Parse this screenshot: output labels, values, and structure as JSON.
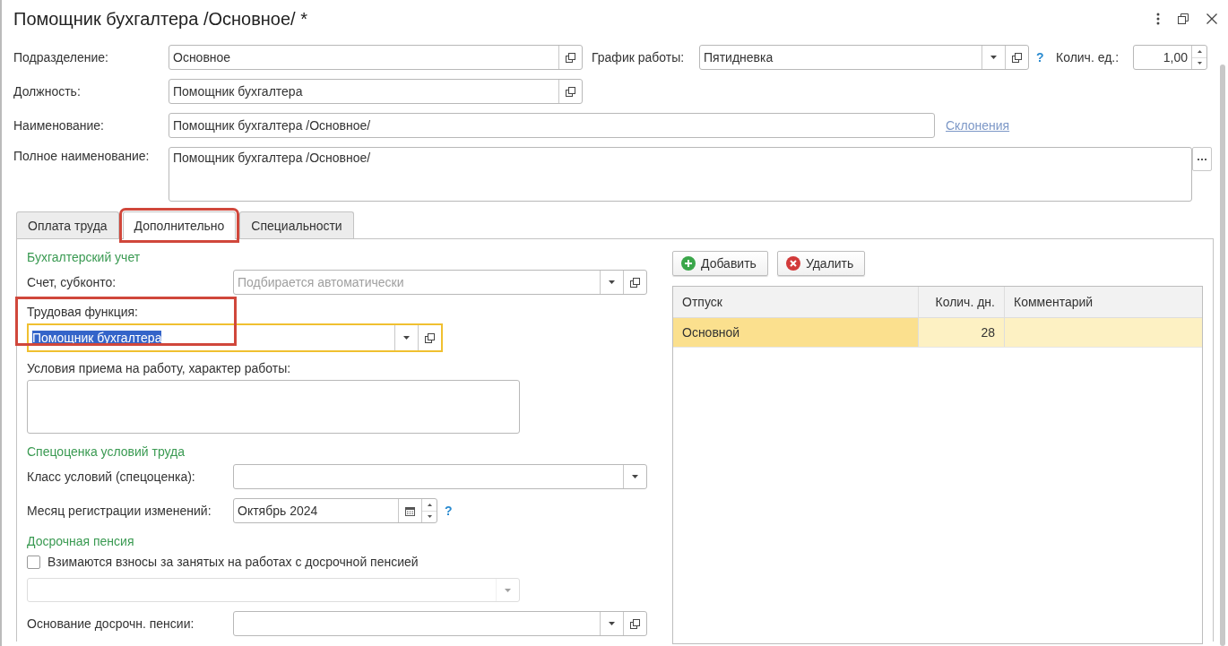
{
  "window": {
    "title": "Помощник бухгалтера /Основное/ *"
  },
  "header_rows": [
    [
      {
        "label": "Подразделение:",
        "value": "Основное",
        "controls": [
          {
            "kind": "open"
          }
        ]
      },
      {
        "label": "График работы:",
        "value": "Пятидневка",
        "controls": [
          {
            "kind": "dropdown"
          },
          {
            "kind": "open"
          }
        ],
        "help": "?"
      },
      {
        "label": "Колич. ед.:",
        "value": "1,00",
        "controls": [
          {
            "kind": "spin"
          }
        ]
      }
    ],
    [
      {
        "label": "Должность:",
        "value": "Помощник бухгалтера",
        "controls": [
          {
            "kind": "open"
          }
        ]
      }
    ],
    [
      {
        "label": "Наименование:",
        "value": "Помощник бухгалтера /Основное/",
        "link": "Склонения"
      }
    ],
    [
      {
        "label": "Полное наименование:",
        "value": "Помощник бухгалтера /Основное/",
        "controls": [
          {
            "kind": "more"
          }
        ],
        "multiline": true
      }
    ]
  ],
  "tabs": [
    {
      "label": "Оплата труда",
      "selected": false,
      "highlighted": false
    },
    {
      "label": "Дополнительно",
      "selected": true,
      "highlighted": true
    },
    {
      "label": "Специальности",
      "selected": false,
      "highlighted": false
    }
  ],
  "left_panel": [
    {
      "kind": "heading",
      "text": "Бухгалтерский учет"
    },
    {
      "kind": "inline_field",
      "label": "Счет, субконто:",
      "placeholder": "Подбирается автоматически",
      "controls": [
        {
          "kind": "dropdown"
        },
        {
          "kind": "open"
        }
      ],
      "focused": false
    },
    {
      "kind": "stacked_field",
      "label": "Трудовая функция:",
      "value": "Помощник бухгалтера",
      "controls": [
        {
          "kind": "dropdown"
        },
        {
          "kind": "open"
        }
      ],
      "focused": true,
      "highlighted": true
    },
    {
      "kind": "textarea",
      "label": "Условия приема на работу, характер работы:"
    },
    {
      "kind": "heading",
      "text": "Спецоценка условий труда"
    },
    {
      "kind": "inline_field",
      "label": "Класс условий (спецоценка):",
      "controls": [
        {
          "kind": "dropdown"
        }
      ],
      "focused": false
    },
    {
      "kind": "date_field",
      "label": "Месяц регистрации изменений:",
      "value": "Октябрь 2024",
      "controls": [
        {
          "kind": "calendar"
        },
        {
          "kind": "spin"
        }
      ],
      "help": "?",
      "focused": false
    },
    {
      "kind": "heading",
      "text": "Досрочная пенсия"
    },
    {
      "kind": "checkbox",
      "label": "Взимаются взносы за занятых на работах с досрочной пенсией",
      "checked": false
    },
    {
      "kind": "select",
      "disabled": true,
      "controls": [
        {
          "kind": "dropdown"
        }
      ]
    },
    {
      "kind": "inline_field",
      "label": "Основание досрочн. пенсии:",
      "controls": [
        {
          "kind": "dropdown"
        },
        {
          "kind": "open"
        }
      ],
      "focused": false
    }
  ],
  "buttons": [
    {
      "label": "Добавить",
      "kind": "add"
    },
    {
      "label": "Удалить",
      "kind": "delete"
    }
  ],
  "table": {
    "columns": [
      "Отпуск",
      "Колич. дн.",
      "Комментарий"
    ],
    "rows": [
      {
        "cells": [
          "Основной",
          "28"
        ],
        "selected": true
      }
    ]
  }
}
